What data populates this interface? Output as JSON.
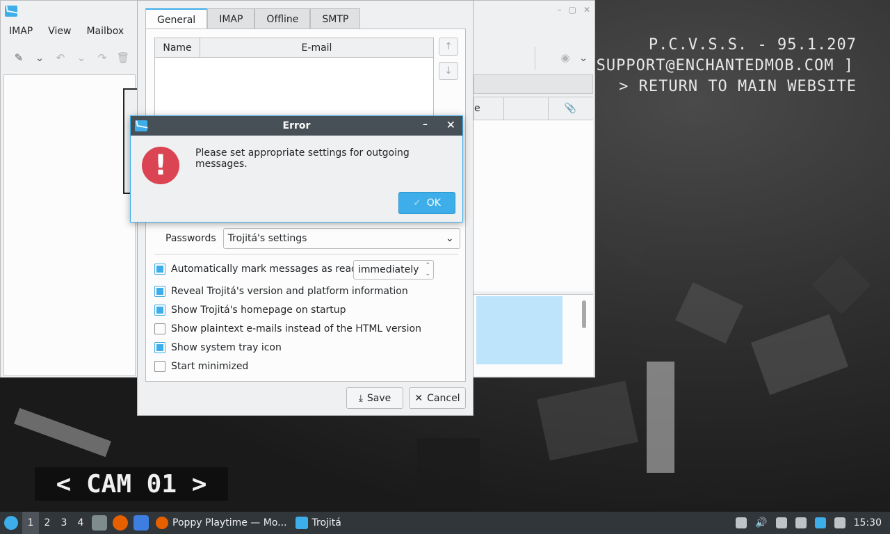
{
  "desktop": {
    "overlay_lines": [
      "P.C.V.S.S. - 95.1.207",
      "SUPPORT@ENCHANTEDMOB.COM ]",
      "> RETURN TO MAIN WEBSITE"
    ],
    "cam_label": "< CAM 01 >"
  },
  "main_window": {
    "menu": [
      "IMAP",
      "View",
      "Mailbox"
    ],
    "message_list_partial_header": "e"
  },
  "settings": {
    "tabs": [
      "General",
      "IMAP",
      "Offline",
      "SMTP"
    ],
    "active_tab": "General",
    "identity_table": {
      "col_name": "Name",
      "col_email": "E-mail"
    },
    "passwords_label": "Passwords",
    "passwords_value": "Trojitá's settings",
    "options": [
      {
        "label": "Automatically mark messages as read",
        "checked": true
      },
      {
        "label": "Reveal Trojitá's version and platform information",
        "checked": true
      },
      {
        "label": "Show Trojitá's homepage on startup",
        "checked": true
      },
      {
        "label": "Show plaintext e-mails instead of the HTML version",
        "checked": false
      },
      {
        "label": "Show system tray icon",
        "checked": true
      },
      {
        "label": "Start minimized",
        "checked": false
      }
    ],
    "mark_read_value": "immediately",
    "save_label": "Save",
    "cancel_label": "Cancel"
  },
  "error_dialog": {
    "title": "Error",
    "message": "Please set appropriate settings for outgoing messages.",
    "ok_label": "OK"
  },
  "taskbar": {
    "desktops": [
      "1",
      "2",
      "3",
      "4"
    ],
    "tasks": [
      "Poppy Playtime — Mo...",
      "Trojitá"
    ],
    "clock": "15:30"
  },
  "colors": {
    "accent": "#3daee9",
    "error": "#da4453",
    "taskbar": "#31363b"
  }
}
